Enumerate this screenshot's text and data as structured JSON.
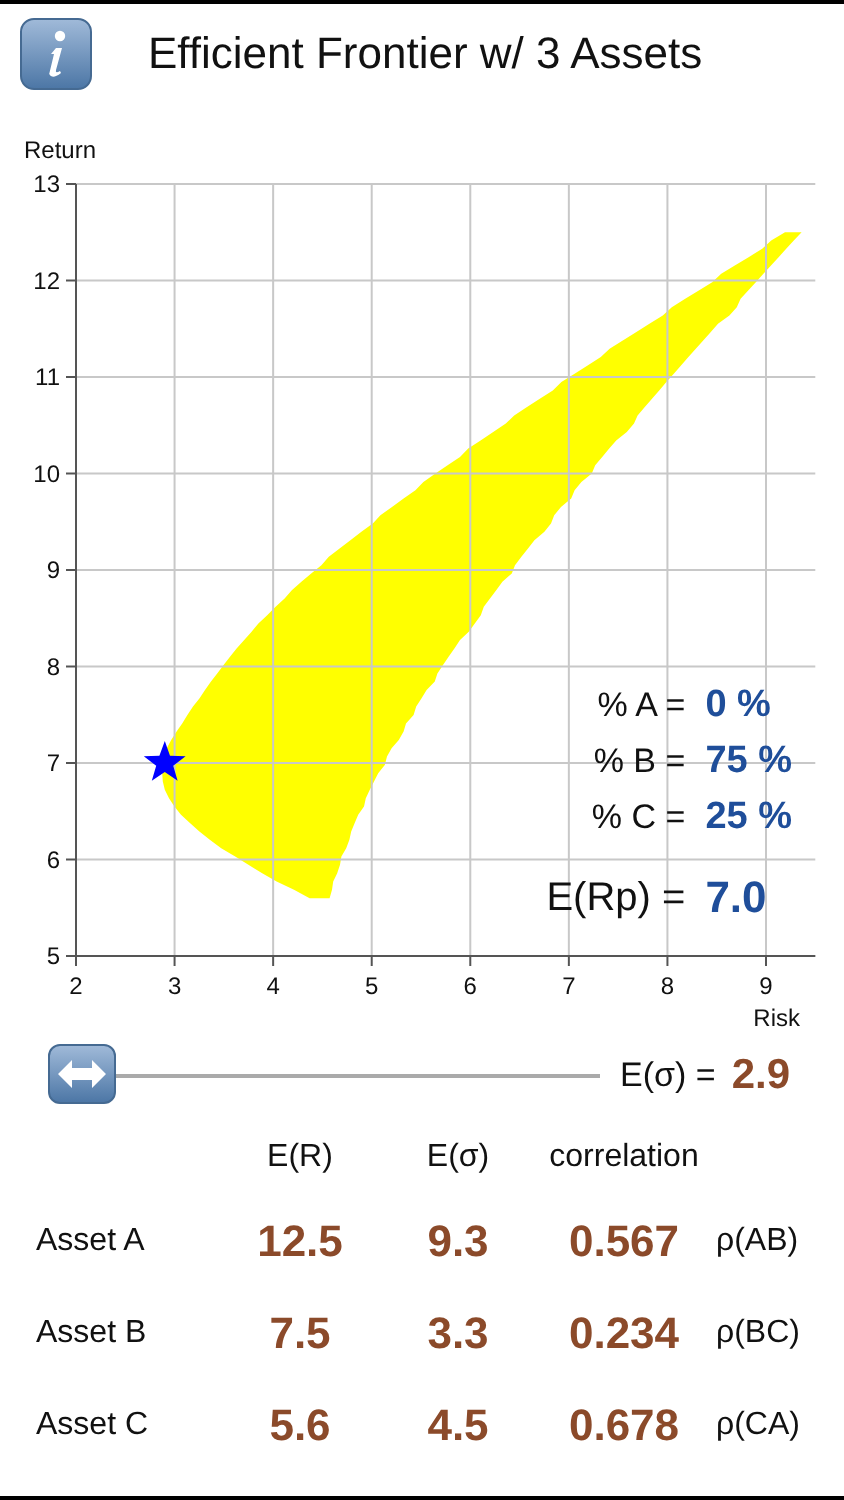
{
  "header": {
    "title": "Efficient Frontier w/ 3 Assets"
  },
  "chart": {
    "chart_data": {
      "type": "scatter",
      "grid": true,
      "xlabel": "Risk",
      "ylabel": "Return",
      "xlim": [
        2,
        9.5
      ],
      "ylim": [
        5,
        13
      ],
      "xticks": [
        2,
        3,
        4,
        5,
        6,
        7,
        8,
        9
      ],
      "yticks": [
        5,
        6,
        7,
        8,
        9,
        10,
        11,
        12,
        13
      ],
      "x": [
        2.9
      ],
      "series": [
        {
          "color": "#0000ff",
          "values": [
            7.0
          ]
        }
      ]
    },
    "weights": [
      {
        "label": "% A =",
        "value": "0 %"
      },
      {
        "label": "% B =",
        "value": "75 %"
      },
      {
        "label": "% C =",
        "value": "25 %"
      }
    ],
    "expected_return": {
      "label": "E(Rp) =",
      "value": "7.0"
    }
  },
  "slider": {
    "label": "E(σ) =",
    "value": "2.9"
  },
  "table": {
    "columns": [
      "E(R)",
      "E(σ)",
      "correlation"
    ],
    "rows": [
      {
        "name": "Asset A",
        "values": [
          "12.5",
          "9.3",
          "0.567"
        ],
        "pair": "ρ(AB)"
      },
      {
        "name": "Asset B",
        "values": [
          "7.5",
          "3.3",
          "0.234"
        ],
        "pair": "ρ(BC)"
      },
      {
        "name": "Asset C",
        "values": [
          "5.6",
          "4.5",
          "0.678"
        ],
        "pair": "ρ(CA)"
      }
    ]
  }
}
